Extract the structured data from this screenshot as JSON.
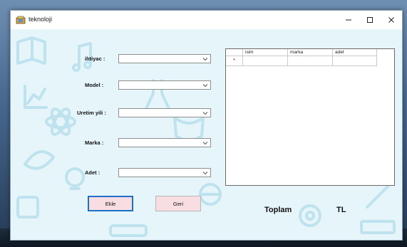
{
  "window": {
    "title": "teknoloji"
  },
  "form": {
    "fields": [
      {
        "label": "ihtiyac :",
        "value": ""
      },
      {
        "label": "Model :",
        "value": ""
      },
      {
        "label": "Uretim yili :",
        "value": ""
      },
      {
        "label": "Marka :",
        "value": ""
      },
      {
        "label": "Adet :",
        "value": ""
      }
    ]
  },
  "grid": {
    "columns": [
      "isim",
      "marka",
      "adet"
    ],
    "new_row_marker": "*",
    "rows": [
      [
        "",
        "",
        ""
      ]
    ]
  },
  "buttons": {
    "add": "Ekle",
    "back": "Geri"
  },
  "total": {
    "label": "Toplam",
    "value": "",
    "currency": "TL"
  },
  "colors": {
    "button_fill": "#f8dde2",
    "focus_border": "#1e6fc8",
    "background_tint": "#e6f5fa",
    "pattern_icons": "#bfe3ee"
  }
}
